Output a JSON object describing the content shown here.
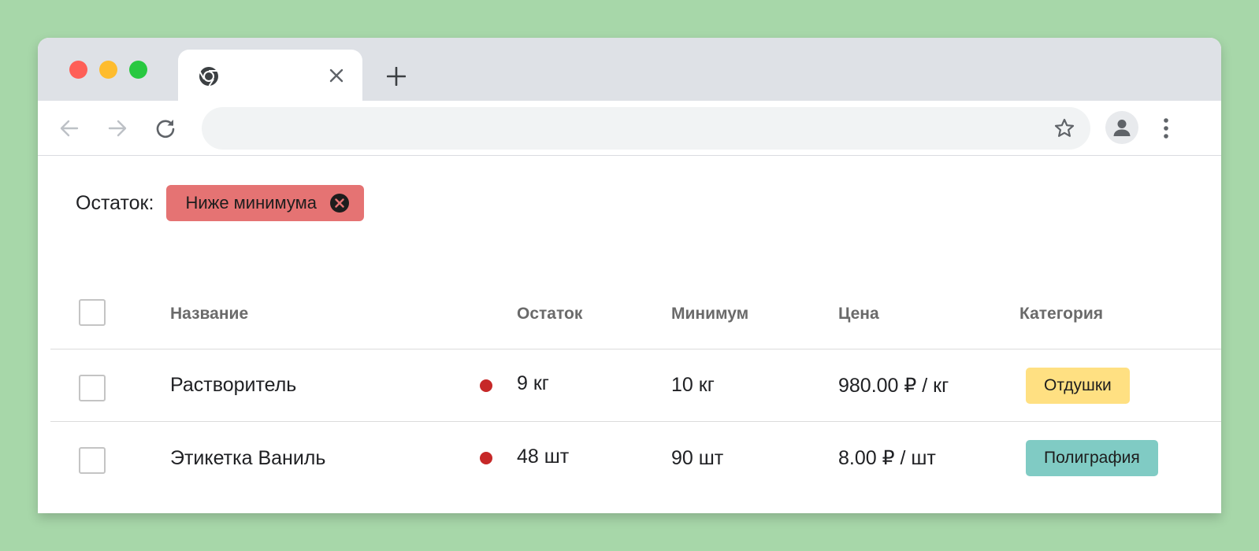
{
  "browser": {
    "tab": {
      "title": "",
      "favicon": "chrome-icon",
      "close_icon": "close-icon"
    },
    "new_tab_icon": "plus-icon",
    "toolbar": {
      "back_icon": "arrow-left-icon",
      "forward_icon": "arrow-right-icon",
      "reload_icon": "reload-icon",
      "address": "",
      "bookmark_icon": "star-icon",
      "profile_icon": "person-icon",
      "menu_icon": "more-vert-icon"
    }
  },
  "filter": {
    "label": "Остаток:",
    "chip": {
      "text": "Ниже минимума",
      "color": "#e57373"
    }
  },
  "table": {
    "columns": [
      "Название",
      "Остаток",
      "Минимум",
      "Цена",
      "Категория"
    ],
    "rows": [
      {
        "name": "Растворитель",
        "status": "below-minimum",
        "stock": "9 кг",
        "minimum": "10 кг",
        "price": "980.00 ₽ / кг",
        "category": "Отдушки",
        "category_color": "#ffe082"
      },
      {
        "name": "Этикетка Ваниль",
        "status": "below-minimum",
        "stock": "48 шт",
        "minimum": "90 шт",
        "price": "8.00 ₽ / шт",
        "category": "Полиграфия",
        "category_color": "#80cbc4"
      }
    ]
  },
  "colors": {
    "background": "#a7d7a9",
    "status_dot": "#c62828"
  }
}
